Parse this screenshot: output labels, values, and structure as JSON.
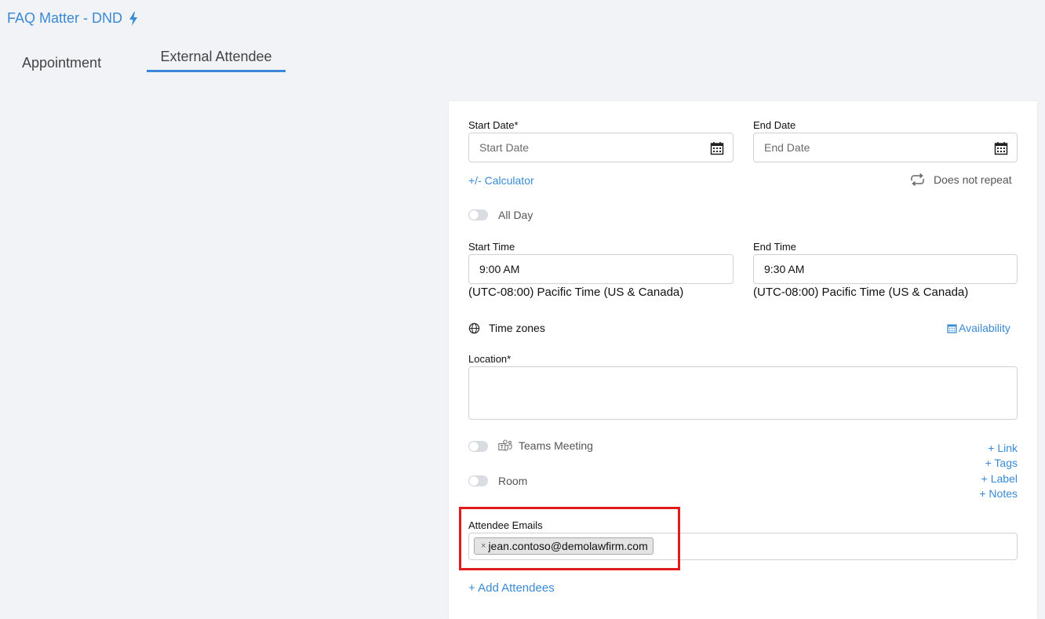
{
  "header": {
    "title": "FAQ Matter - DND"
  },
  "tabs": [
    {
      "label": "Appointment"
    },
    {
      "label": "External Attendee"
    }
  ],
  "form": {
    "start_date": {
      "label": "Start Date*",
      "placeholder": "Start Date",
      "value": ""
    },
    "end_date": {
      "label": "End Date",
      "placeholder": "End Date",
      "value": ""
    },
    "calculator_link": "+/- Calculator",
    "repeat_label": "Does not repeat",
    "all_day_label": "All Day",
    "all_day_on": false,
    "start_time": {
      "label": "Start Time",
      "value": "9:00 AM",
      "timezone": "(UTC-08:00) Pacific Time (US & Canada)"
    },
    "end_time": {
      "label": "End Time",
      "value": "9:30 AM",
      "timezone": "(UTC-08:00) Pacific Time (US & Canada)"
    },
    "time_zones_label": "Time zones",
    "availability_link": "Availability",
    "location": {
      "label": "Location*",
      "value": ""
    },
    "teams_meeting_label": "Teams Meeting",
    "teams_meeting_on": false,
    "room_label": "Room",
    "room_on": false,
    "side_links": [
      "+ Link",
      "+ Tags",
      "+ Label",
      "+ Notes"
    ],
    "attendee_emails": {
      "label": "Attendee Emails",
      "emails": [
        "jean.contoso@demolawfirm.com"
      ]
    },
    "add_attendees_link": "+ Add Attendees"
  },
  "colors": {
    "accent": "#3a8ad3",
    "tab_underline": "#3a86d8",
    "highlight_box": "#e01b1b",
    "background": "#f1f3f7"
  }
}
